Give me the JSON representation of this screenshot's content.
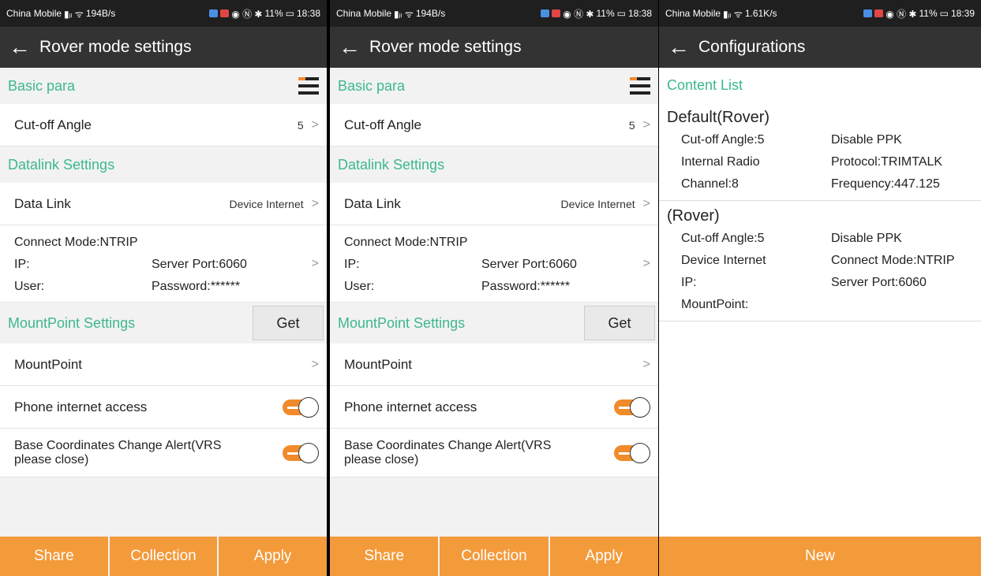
{
  "status_left": {
    "carrier": "China Mobile",
    "speed_a": "194B/s",
    "speed_b": "1.61K/s"
  },
  "status_right": {
    "battery": "11%",
    "time_a": "18:38",
    "time_b": "18:39"
  },
  "rover": {
    "title": "Rover mode settings",
    "basic_para": "Basic para",
    "cutoff_label": "Cut-off Angle",
    "cutoff_value": "5",
    "datalink_section": "Datalink Settings",
    "datalink_label": "Data Link",
    "datalink_value": "Device Internet",
    "connect_mode": "Connect Mode:NTRIP",
    "ip": "IP:",
    "server_port": "Server Port:6060",
    "user": "User:",
    "password": "Password:******",
    "mountpoint_section": "MountPoint Settings",
    "get": "Get",
    "mountpoint_label": "MountPoint",
    "phone_internet": "Phone internet access",
    "base_alert_1": "Base Coordinates Change Alert(VRS",
    "base_alert_2": "please close)",
    "btn_share": "Share",
    "btn_collection": "Collection",
    "btn_apply": "Apply"
  },
  "config": {
    "title": "Configurations",
    "content_list": "Content List",
    "block1": {
      "title": "Default(Rover)",
      "r1a": "Cut-off Angle:5",
      "r1b": "Disable PPK",
      "r2a": "Internal Radio",
      "r2b": "Protocol:TRIMTALK",
      "r3a": "Channel:8",
      "r3b": "Frequency:447.125"
    },
    "block2": {
      "title": "(Rover)",
      "r1a": "Cut-off Angle:5",
      "r1b": "Disable PPK",
      "r2a": "Device Internet",
      "r2b": "Connect Mode:NTRIP",
      "r3a": "IP:",
      "r3b": "Server Port:6060",
      "r4a": "MountPoint:"
    },
    "btn_new": "New"
  },
  "colors": {
    "accent": "#3cb88e",
    "orange": "#f39a3a",
    "titlebar": "#333333"
  }
}
